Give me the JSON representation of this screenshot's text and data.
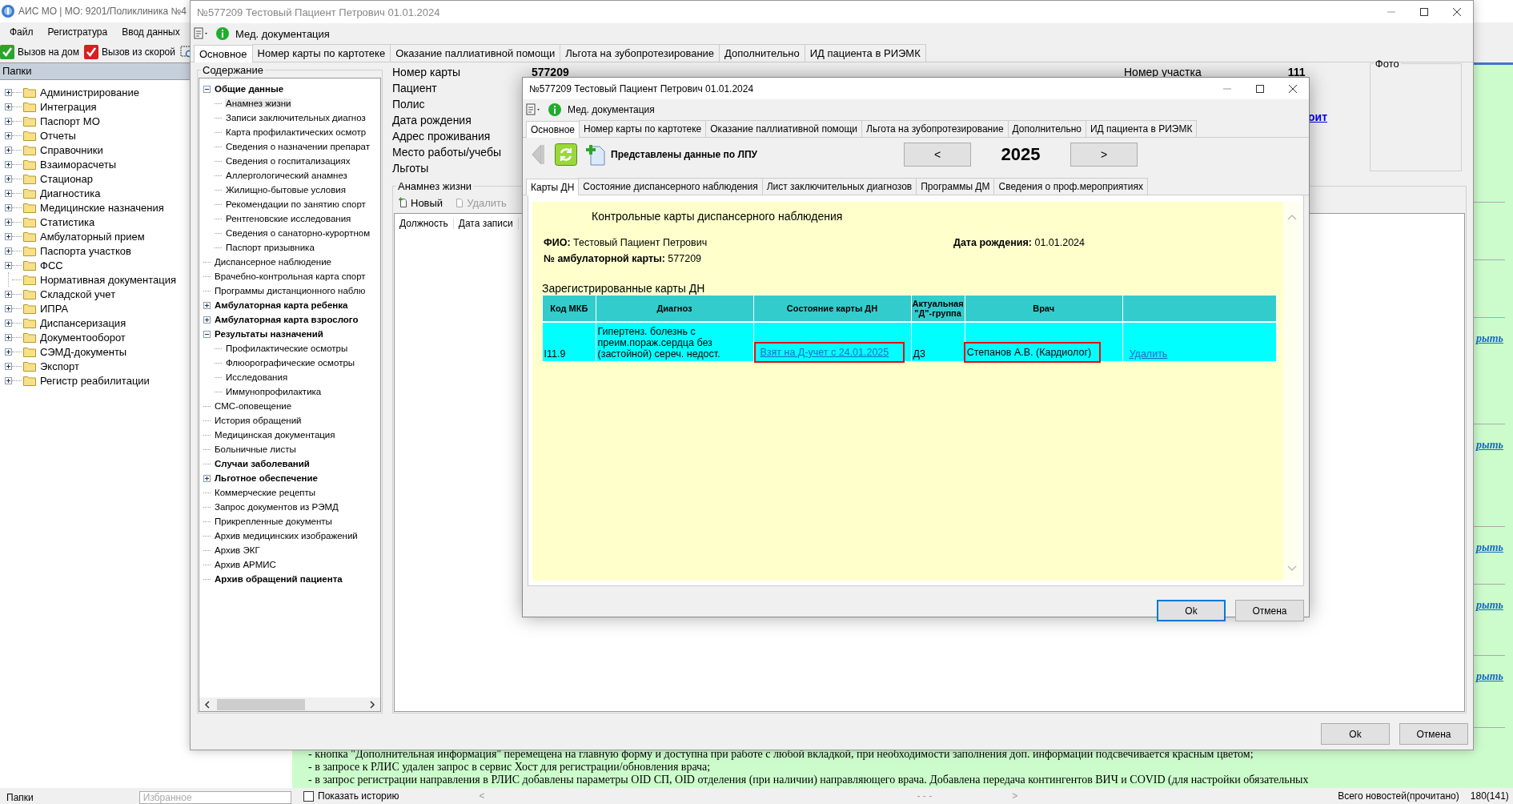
{
  "app": {
    "title": "АИС МО | МО: 9201/Поликлиника №4",
    "menu": [
      "Файл",
      "Регистратура",
      "Ввод данных"
    ],
    "toolbar": [
      {
        "label": "Вызов на дом",
        "kind": "home"
      },
      {
        "label": "Вызов из скорой",
        "kind": "ambulance"
      }
    ],
    "folders": {
      "title": "Папки",
      "items": [
        {
          "label": "Администрирование",
          "expandable": true
        },
        {
          "label": "Интеграция",
          "expandable": true
        },
        {
          "label": "Паспорт МО",
          "expandable": true
        },
        {
          "label": "Отчеты",
          "expandable": true
        },
        {
          "label": "Справочники",
          "expandable": true
        },
        {
          "label": "Взаиморасчеты",
          "expandable": true
        },
        {
          "label": "Стационар",
          "expandable": true
        },
        {
          "label": "Диагностика",
          "expandable": true
        },
        {
          "label": "Медицинские назначения",
          "expandable": true
        },
        {
          "label": "Статистика",
          "expandable": true
        },
        {
          "label": "Амбулаторный прием",
          "expandable": true
        },
        {
          "label": "Паспорта участков",
          "expandable": true
        },
        {
          "label": "ФСС",
          "expandable": true
        },
        {
          "label": "Нормативная документация",
          "expandable": false
        },
        {
          "label": "Складской учет",
          "expandable": true
        },
        {
          "label": "ИПРА",
          "expandable": true
        },
        {
          "label": "Диспансеризация",
          "expandable": true
        },
        {
          "label": "Документооборот",
          "expandable": true
        },
        {
          "label": "СЭМД-документы",
          "expandable": true
        },
        {
          "label": "Экспорт",
          "expandable": true
        },
        {
          "label": "Регистр реабилитации",
          "expandable": true
        }
      ]
    },
    "news": {
      "links": [
        "рыть",
        "рыть",
        "рыть",
        "рыть",
        "рыть"
      ],
      "lines": [
        "- кнопка \"Дополнительная информация\" перемещена на главную форму и доступна при работе с любой вкладкой, при необходимости заполнения доп. информации подсвечивается красным цветом;",
        "- в запросе к РЛИС удален запрос в сервис Хост для регистрации/обновления врача;",
        "- в запрос регистрации направления в РЛИС добавлены параметры OID СП, OID отделения (при наличии) направляющего врача. Добавлена передача контингентов ВИЧ и COVID (для настройки обязательных"
      ]
    },
    "status_bar": {
      "tab": "Папки",
      "favorites_placeholder": "Избранное",
      "show_history": {
        "label": "Показать историю",
        "checked": false
      },
      "prev": "<",
      "pages": "- - -",
      "next": ">",
      "total_label": "Всего новостей(прочитано)",
      "total": "180(141)"
    }
  },
  "med_window": {
    "title": "№577209 Тестовый Пациент Петрович 01.01.2024",
    "toolbar_label": "Мед. документация",
    "tabs": [
      {
        "label": "Основное",
        "selected": true
      },
      {
        "label": "Номер карты по картотеке",
        "selected": false
      },
      {
        "label": "Оказание паллиативной помощи",
        "selected": false
      },
      {
        "label": "Льгота на зубопротезирование",
        "selected": false
      },
      {
        "label": "Дополнительно",
        "selected": false
      },
      {
        "label": "ИД пациента в РИЭМК",
        "selected": false
      }
    ],
    "contents": {
      "title": "Содержание",
      "tree": [
        {
          "label": "Общие данные",
          "bold": true,
          "selected": false,
          "expanded": true,
          "children": [
            {
              "label": "Анамнез жизни",
              "bold": false,
              "selected": true
            },
            {
              "label": "Записи заключительных диагноз",
              "bold": false,
              "selected": false
            },
            {
              "label": "Карта профилактических осмотр",
              "bold": false,
              "selected": false
            },
            {
              "label": "Сведения о назначении препарат",
              "bold": false,
              "selected": false
            },
            {
              "label": "Сведения о госпитализациях",
              "bold": false,
              "selected": false
            },
            {
              "label": "Аллергологический анамнез",
              "bold": false,
              "selected": false
            },
            {
              "label": "Жилищно-бытовые условия",
              "bold": false,
              "selected": false
            },
            {
              "label": "Рекомендации по занятию спорт",
              "bold": false,
              "selected": false
            },
            {
              "label": "Рентгеновские исследования",
              "bold": false,
              "selected": false
            },
            {
              "label": "Сведения о санаторно-курортном",
              "bold": false,
              "selected": false
            },
            {
              "label": "Паспорт призывника",
              "bold": false,
              "selected": false
            }
          ]
        },
        {
          "label": "Диспансерное наблюдение",
          "bold": false,
          "selected": false
        },
        {
          "label": "Врачебно-контрольная карта спорт",
          "bold": false,
          "selected": false
        },
        {
          "label": "Программы дистанционного наблю",
          "bold": false,
          "selected": false
        },
        {
          "label": "Амбулаторная карта ребенка",
          "bold": true,
          "selected": false,
          "expanded": false
        },
        {
          "label": "Амбулаторная карта взрослого",
          "bold": true,
          "selected": false,
          "expanded": false
        },
        {
          "label": "Результаты назначений",
          "bold": true,
          "selected": false,
          "expanded": true,
          "children": [
            {
              "label": "Профилактические осмотры",
              "bold": false,
              "selected": false
            },
            {
              "label": "Флюорографические осмотры",
              "bold": false,
              "selected": false
            },
            {
              "label": "Исследования",
              "bold": false,
              "selected": false
            },
            {
              "label": "Иммунопрофилактика",
              "bold": false,
              "selected": false
            }
          ]
        },
        {
          "label": "СМС-оповещение",
          "bold": false,
          "selected": false
        },
        {
          "label": "История обращений",
          "bold": false,
          "selected": false
        },
        {
          "label": "Медицинская документация",
          "bold": false,
          "selected": false
        },
        {
          "label": "Больничные листы",
          "bold": false,
          "selected": false
        },
        {
          "label": "Случаи заболеваний",
          "bold": true,
          "selected": false
        },
        {
          "label": "Льготное обеспечение",
          "bold": true,
          "selected": false,
          "expanded": false
        },
        {
          "label": "Коммерческие рецепты",
          "bold": false,
          "selected": false
        },
        {
          "label": "Запрос документов из РЭМД",
          "bold": false,
          "selected": false
        },
        {
          "label": "Прикрепленные документы",
          "bold": false,
          "selected": false
        },
        {
          "label": "Архив медицинских изображений",
          "bold": false,
          "selected": false
        },
        {
          "label": "Архив ЭКГ",
          "bold": false,
          "selected": false
        },
        {
          "label": "Архив АРМИС",
          "bold": false,
          "selected": false
        },
        {
          "label": "Архив обращений пациента",
          "bold": true,
          "selected": false
        }
      ]
    },
    "fields": [
      {
        "label": "Номер карты",
        "value": "577209"
      },
      {
        "label": "Пациент"
      },
      {
        "label": "Полис"
      },
      {
        "label": "Дата рождения"
      },
      {
        "label": "Адрес проживания"
      },
      {
        "label": "Место работы/учебы"
      },
      {
        "label": "Льготы"
      }
    ],
    "district": {
      "label": "Номер участка",
      "value": "111"
    },
    "link": "оит",
    "photo": {
      "title": "Фото"
    },
    "section": {
      "title": "Анамнез жизни",
      "toolbar": [
        {
          "label": "Новый",
          "disabled": false
        },
        {
          "label": "Удалить",
          "disabled": true
        }
      ],
      "columns": [
        "Должность",
        "Дата записи"
      ]
    },
    "buttons": [
      "Ok",
      "Отмена"
    ]
  },
  "dialog": {
    "title": "№577209 Тестовый Пациент Петрович 01.01.2024",
    "toolbar_label": "Мед. документация",
    "tabs": [
      {
        "label": "Основное",
        "selected": true
      },
      {
        "label": "Номер карты по картотеке",
        "selected": false
      },
      {
        "label": "Оказание паллиативной помощи",
        "selected": false
      },
      {
        "label": "Льгота на зубопротезирование",
        "selected": false
      },
      {
        "label": "Дополнительно",
        "selected": false
      },
      {
        "label": "ИД пациента в РИЭМК",
        "selected": false
      }
    ],
    "nav": {
      "label": "Представлены данные по ЛПУ",
      "prev": "<",
      "year": "2025",
      "next": ">"
    },
    "subtabs": [
      {
        "label": "Карты ДН",
        "selected": true
      },
      {
        "label": "Состояние диспансерного наблюдения",
        "selected": false
      },
      {
        "label": "Лист заключительных диагнозов",
        "selected": false
      },
      {
        "label": "Программы ДМ",
        "selected": false
      },
      {
        "label": "Сведения о проф.мероприятиях",
        "selected": false
      }
    ],
    "heading": "Контрольные карты диспансерного наблюдения",
    "fio": "**ФИО:** Тестовый Пациент Петрович",
    "birth": "**Дата рождения:** 01.01.2024",
    "card": "**№ амбулаторной карты:** 577209",
    "table": {
      "caption": "Зарегистрированные карты ДН",
      "columns": [
        "Код МКБ",
        "Диагноз",
        "Состояние карты ДН",
        "Актуальная \"Д\"-группа",
        "Врач"
      ],
      "rows": [
        {
          "cells": [
            {
              "text": "I11.9",
              "kind": "text",
              "highlighted": false
            },
            {
              "text": "Гипертенз. болезнь с преим.пораж.сердца без (застойной) сереч. недост.",
              "kind": "text",
              "highlighted": false
            },
            {
              "text": "Взят на Д-учет с 24.01.2025",
              "kind": "link",
              "highlighted": true
            },
            {
              "text": "Д3",
              "kind": "text",
              "highlighted": false
            },
            {
              "text": "Степанов А.В. (Кардиолог)",
              "kind": "text",
              "highlighted": true
            },
            {
              "text": "Удалить",
              "kind": "link",
              "highlighted": false
            }
          ]
        }
      ]
    },
    "buttons": [
      {
        "label": "Ok",
        "default": true
      },
      {
        "label": "Отмена",
        "default": false
      }
    ]
  }
}
